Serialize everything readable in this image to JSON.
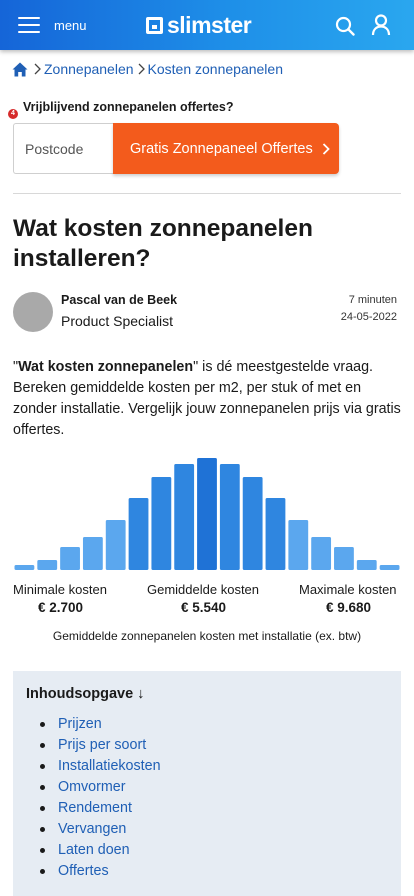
{
  "header": {
    "menu_label": "menu",
    "logo_text": "slimster",
    "brand_gradient": [
      "#1565d8",
      "#2aa7ef"
    ]
  },
  "breadcrumb": {
    "items": [
      "Zonnepanelen",
      "Kosten zonnepanelen"
    ]
  },
  "promo": {
    "badge": "4",
    "title": "Vrijblijvend zonnepanelen offertes?",
    "postcode_placeholder": "Postcode",
    "cta_label": "Gratis Zonnepaneel Offertes",
    "cta_color": "#f35b1c"
  },
  "article": {
    "title": "Wat kosten zonnepanelen installeren?",
    "author_name": "Pascal van de Beek",
    "author_role": "Product Specialist",
    "read_time": "7 minuten",
    "date": "24-05-2022",
    "intro_quote_open": "\"",
    "intro_bold": "Wat kosten zonnepanelen",
    "intro_rest": "\" is dé meestgestelde vraag. Bereken gemiddelde kosten per m2, per stuk of met en zonder installatie. Vergelijk jouw zonnepanelen prijs via gratis offertes."
  },
  "chart_data": {
    "type": "bar",
    "values": [
      5,
      10,
      23,
      33,
      50,
      72,
      93,
      106,
      112,
      106,
      93,
      72,
      50,
      33,
      23,
      10,
      5
    ],
    "highlight_index": 8,
    "colors": {
      "bar": "#5ba7ee",
      "center": "#2f86e0",
      "highlight": "#1f72d6"
    },
    "labels": [
      {
        "text": "Minimale kosten",
        "value": "€ 2.700"
      },
      {
        "text": "Gemiddelde kosten",
        "value": "€ 5.540"
      },
      {
        "text": "Maximale kosten",
        "value": "€ 9.680"
      }
    ],
    "caption": "Gemiddelde zonnepanelen kosten met installatie (ex. btw)"
  },
  "toc": {
    "title": "Inhoudsopgave ↓",
    "items": [
      "Prijzen",
      "Prijs per soort",
      "Installatiekosten",
      "Omvormer",
      "Rendement",
      "Vervangen",
      "Laten doen",
      "Offertes"
    ]
  }
}
